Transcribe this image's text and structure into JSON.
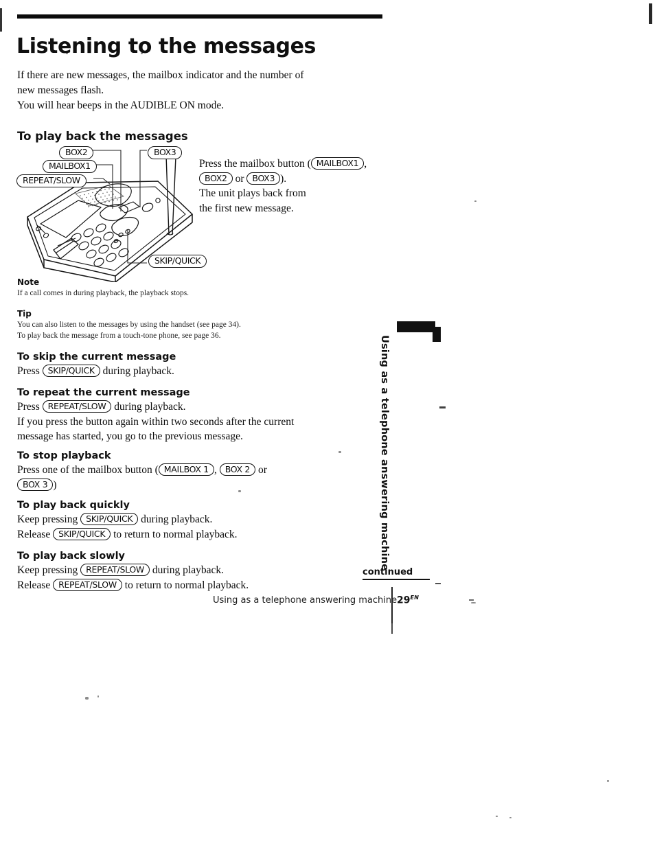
{
  "document": {
    "title": "Listening to the messages",
    "intro_lines": [
      "If there are new messages,  the mailbox indicator and the number of",
      "new messages flash.",
      "You will hear beeps in the AUDIBLE ON mode."
    ]
  },
  "figure": {
    "section_heading": "To play back the messages",
    "callouts": {
      "box2": "BOX2",
      "box3": "BOX3",
      "mailbox1": "MAILBOX1",
      "repeat_slow": "REPEAT/SLOW",
      "skip_quick": "SKIP/QUICK"
    },
    "instruction": {
      "line1_pre": "Press the mailbox button (",
      "line1_btn": "MAILBOX1",
      "line1_post": ",",
      "line2_btn1": "BOX2",
      "line2_mid": " or ",
      "line2_btn2": "BOX3",
      "line2_post": ").",
      "line3": "The unit plays back from",
      "line4": "the first new message."
    }
  },
  "note": {
    "label": "Note",
    "text": "If a call comes in during playback, the playback stops."
  },
  "tip": {
    "label": "Tip",
    "line1": "You can also listen to the messages by using the handset (see page 34).",
    "line2": "To play back the message from a touch-tone phone, see page 36."
  },
  "sections": {
    "skip": {
      "title": "To skip the current message",
      "pre": "Press ",
      "btn": "SKIP/QUICK",
      "post": " during playback."
    },
    "repeat": {
      "title": "To repeat the current message",
      "pre": "Press ",
      "btn": "REPEAT/SLOW",
      "post": " during playback.",
      "extra1": "If you press the button again within two seconds after the current",
      "extra2": "message has started, you go to the previous message."
    },
    "stop": {
      "title": "To stop playback",
      "pre": "Press one of the mailbox button (",
      "btn1": "MAILBOX 1",
      "mid": ", ",
      "btn2": "BOX 2",
      "post": " or",
      "btn3": "BOX 3",
      "tail": ")"
    },
    "quick": {
      "title": "To play back quickly",
      "line1_pre": "Keep pressing ",
      "line1_btn": "SKIP/QUICK",
      "line1_post": " during playback.",
      "line2_pre": "Release ",
      "line2_btn": "SKIP/QUICK",
      "line2_post": " to return to normal playback."
    },
    "slow": {
      "title": "To play back slowly",
      "line1_pre": "Keep pressing ",
      "line1_btn": "REPEAT/SLOW",
      "line1_post": " during playback.",
      "line2_pre": "Release ",
      "line2_btn": "REPEAT/SLOW",
      "line2_post": " to return to normal playback."
    }
  },
  "sidetab": {
    "text": "Using as a telephone answering machine"
  },
  "footer": {
    "continued": "continued",
    "running_head": "Using as a telephone answering machine",
    "page_number": "29",
    "page_suffix": "EN"
  },
  "colors": {
    "ink": "#0b0b0b",
    "paper": "#ffffff"
  }
}
